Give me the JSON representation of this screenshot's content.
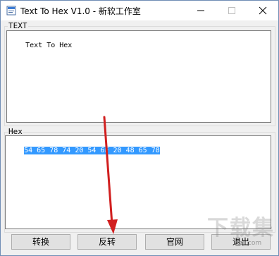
{
  "window": {
    "title": "Text To Hex V1.0 - 新软工作室"
  },
  "text_group": {
    "label": "TEXT",
    "content": "Text To Hex"
  },
  "hex_group": {
    "label": "Hex",
    "content": "54 65 78 74 20 54 6F 20 48 65 78"
  },
  "buttons": {
    "convert": "转换",
    "reverse": "反转",
    "website": "官网",
    "exit": "退出"
  },
  "watermark": {
    "logo": "下载集",
    "url": "xzji.com"
  },
  "annotation": {
    "arrow_color": "#d11f1f"
  }
}
